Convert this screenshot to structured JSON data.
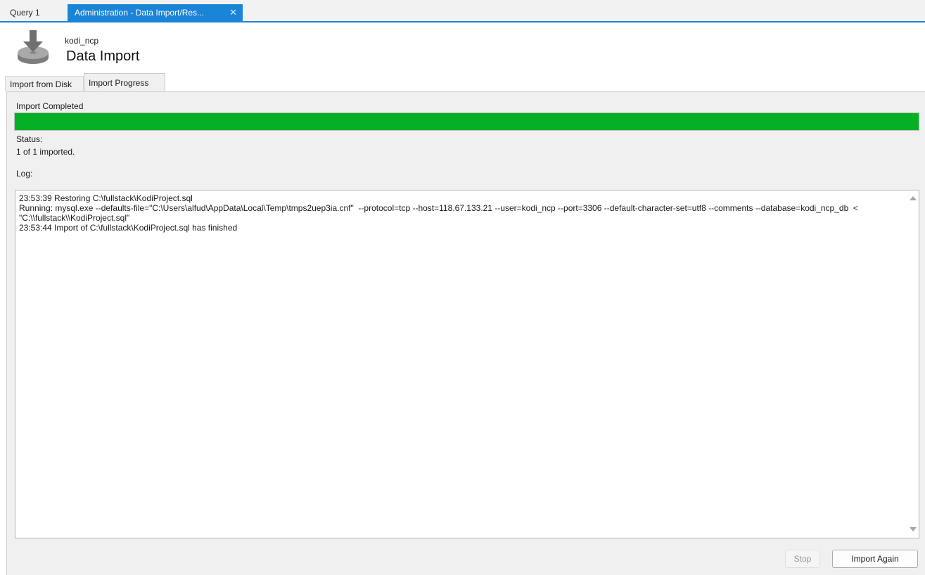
{
  "doc_tabs": [
    {
      "label": "Query 1"
    },
    {
      "label": "Administration - Data Import/Res..."
    }
  ],
  "header": {
    "connection": "kodi_ncp",
    "title": "Data Import",
    "icon": "disk-import-icon"
  },
  "inner_tabs": [
    {
      "label": "Import from Disk"
    },
    {
      "label": "Import Progress"
    }
  ],
  "progress": {
    "label": "Import Completed",
    "percent": 100,
    "color": "#06b025"
  },
  "status": {
    "label": "Status:",
    "value": "1 of 1 imported."
  },
  "log": {
    "label": "Log:",
    "lines": [
      "23:53:39 Restoring C:\\fullstack\\KodiProject.sql",
      "Running: mysql.exe --defaults-file=\"C:\\Users\\alfud\\AppData\\Local\\Temp\\tmps2uep3ia.cnf\"  --protocol=tcp --host=118.67.133.21 --user=kodi_ncp --port=3306 --default-character-set=utf8 --comments --database=kodi_ncp_db  < \"C:\\\\fullstack\\\\KodiProject.sql\"",
      "23:53:44 Import of C:\\fullstack\\KodiProject.sql has finished"
    ]
  },
  "buttons": {
    "stop": "Stop",
    "import_again": "Import Again"
  },
  "colors": {
    "accent": "#1a84d6",
    "progress": "#06b025"
  }
}
